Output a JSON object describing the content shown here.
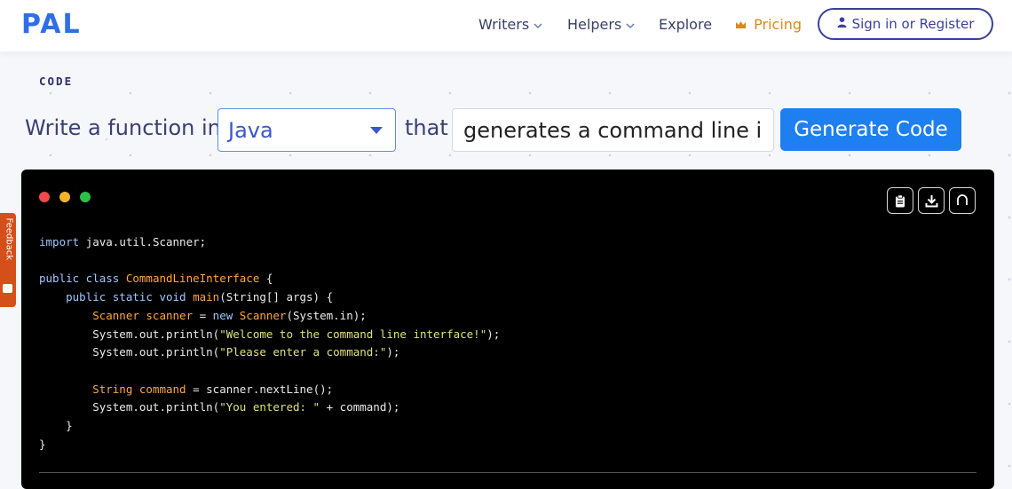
{
  "header": {
    "logo_part1": "CODE",
    "logo_part2": "PAL",
    "nav": {
      "writers": "Writers",
      "helpers": "Helpers",
      "explore": "Explore",
      "pricing": "Pricing"
    },
    "signin": "Sign in or Register"
  },
  "prompt": {
    "prefix": "Write a function in",
    "language": "Java",
    "middle": "that",
    "description": "generates a command line interface",
    "generate_button": "Generate Code"
  },
  "feedback_tab": "Feedback",
  "editor": {
    "code_lines": [
      [
        {
          "t": "import ",
          "c": "kw"
        },
        {
          "t": "java.util.Scanner;",
          "c": "pl"
        }
      ],
      [],
      [
        {
          "t": "public class ",
          "c": "kw"
        },
        {
          "t": "CommandLineInterface",
          "c": "ty"
        },
        {
          "t": " {",
          "c": "pl"
        }
      ],
      [
        {
          "t": "    public static void ",
          "c": "kw"
        },
        {
          "t": "main",
          "c": "ty"
        },
        {
          "t": "(String[] args) {",
          "c": "pl"
        }
      ],
      [
        {
          "t": "        Scanner scanner",
          "c": "ty"
        },
        {
          "t": " = ",
          "c": "pl"
        },
        {
          "t": "new ",
          "c": "kw"
        },
        {
          "t": "Scanner",
          "c": "ty"
        },
        {
          "t": "(System.in);",
          "c": "pl"
        }
      ],
      [
        {
          "t": "        System.out.println(",
          "c": "pl"
        },
        {
          "t": "\"Welcome to the command line interface!\"",
          "c": "st"
        },
        {
          "t": ");",
          "c": "pl"
        }
      ],
      [
        {
          "t": "        System.out.println(",
          "c": "pl"
        },
        {
          "t": "\"Please enter a command:\"",
          "c": "st"
        },
        {
          "t": ");",
          "c": "pl"
        }
      ],
      [],
      [
        {
          "t": "        String command",
          "c": "ty"
        },
        {
          "t": " = scanner.nextLine();",
          "c": "pl"
        }
      ],
      [
        {
          "t": "        System.out.println(",
          "c": "pl"
        },
        {
          "t": "\"You entered: \"",
          "c": "st"
        },
        {
          "t": " + command);",
          "c": "pl"
        }
      ],
      [
        {
          "t": "    }",
          "c": "pl"
        }
      ],
      [
        {
          "t": "}",
          "c": "pl"
        }
      ]
    ]
  },
  "colors": {
    "kw": "#9cc8ff",
    "ty": "#ffa63d",
    "st": "#dfe37a",
    "pl": "#ececec",
    "accent": "#1d7ff0"
  },
  "icons": [
    "user-icon",
    "crown-icon",
    "chevron-down-icon",
    "clipboard-icon",
    "download-icon",
    "refresh-icon"
  ]
}
